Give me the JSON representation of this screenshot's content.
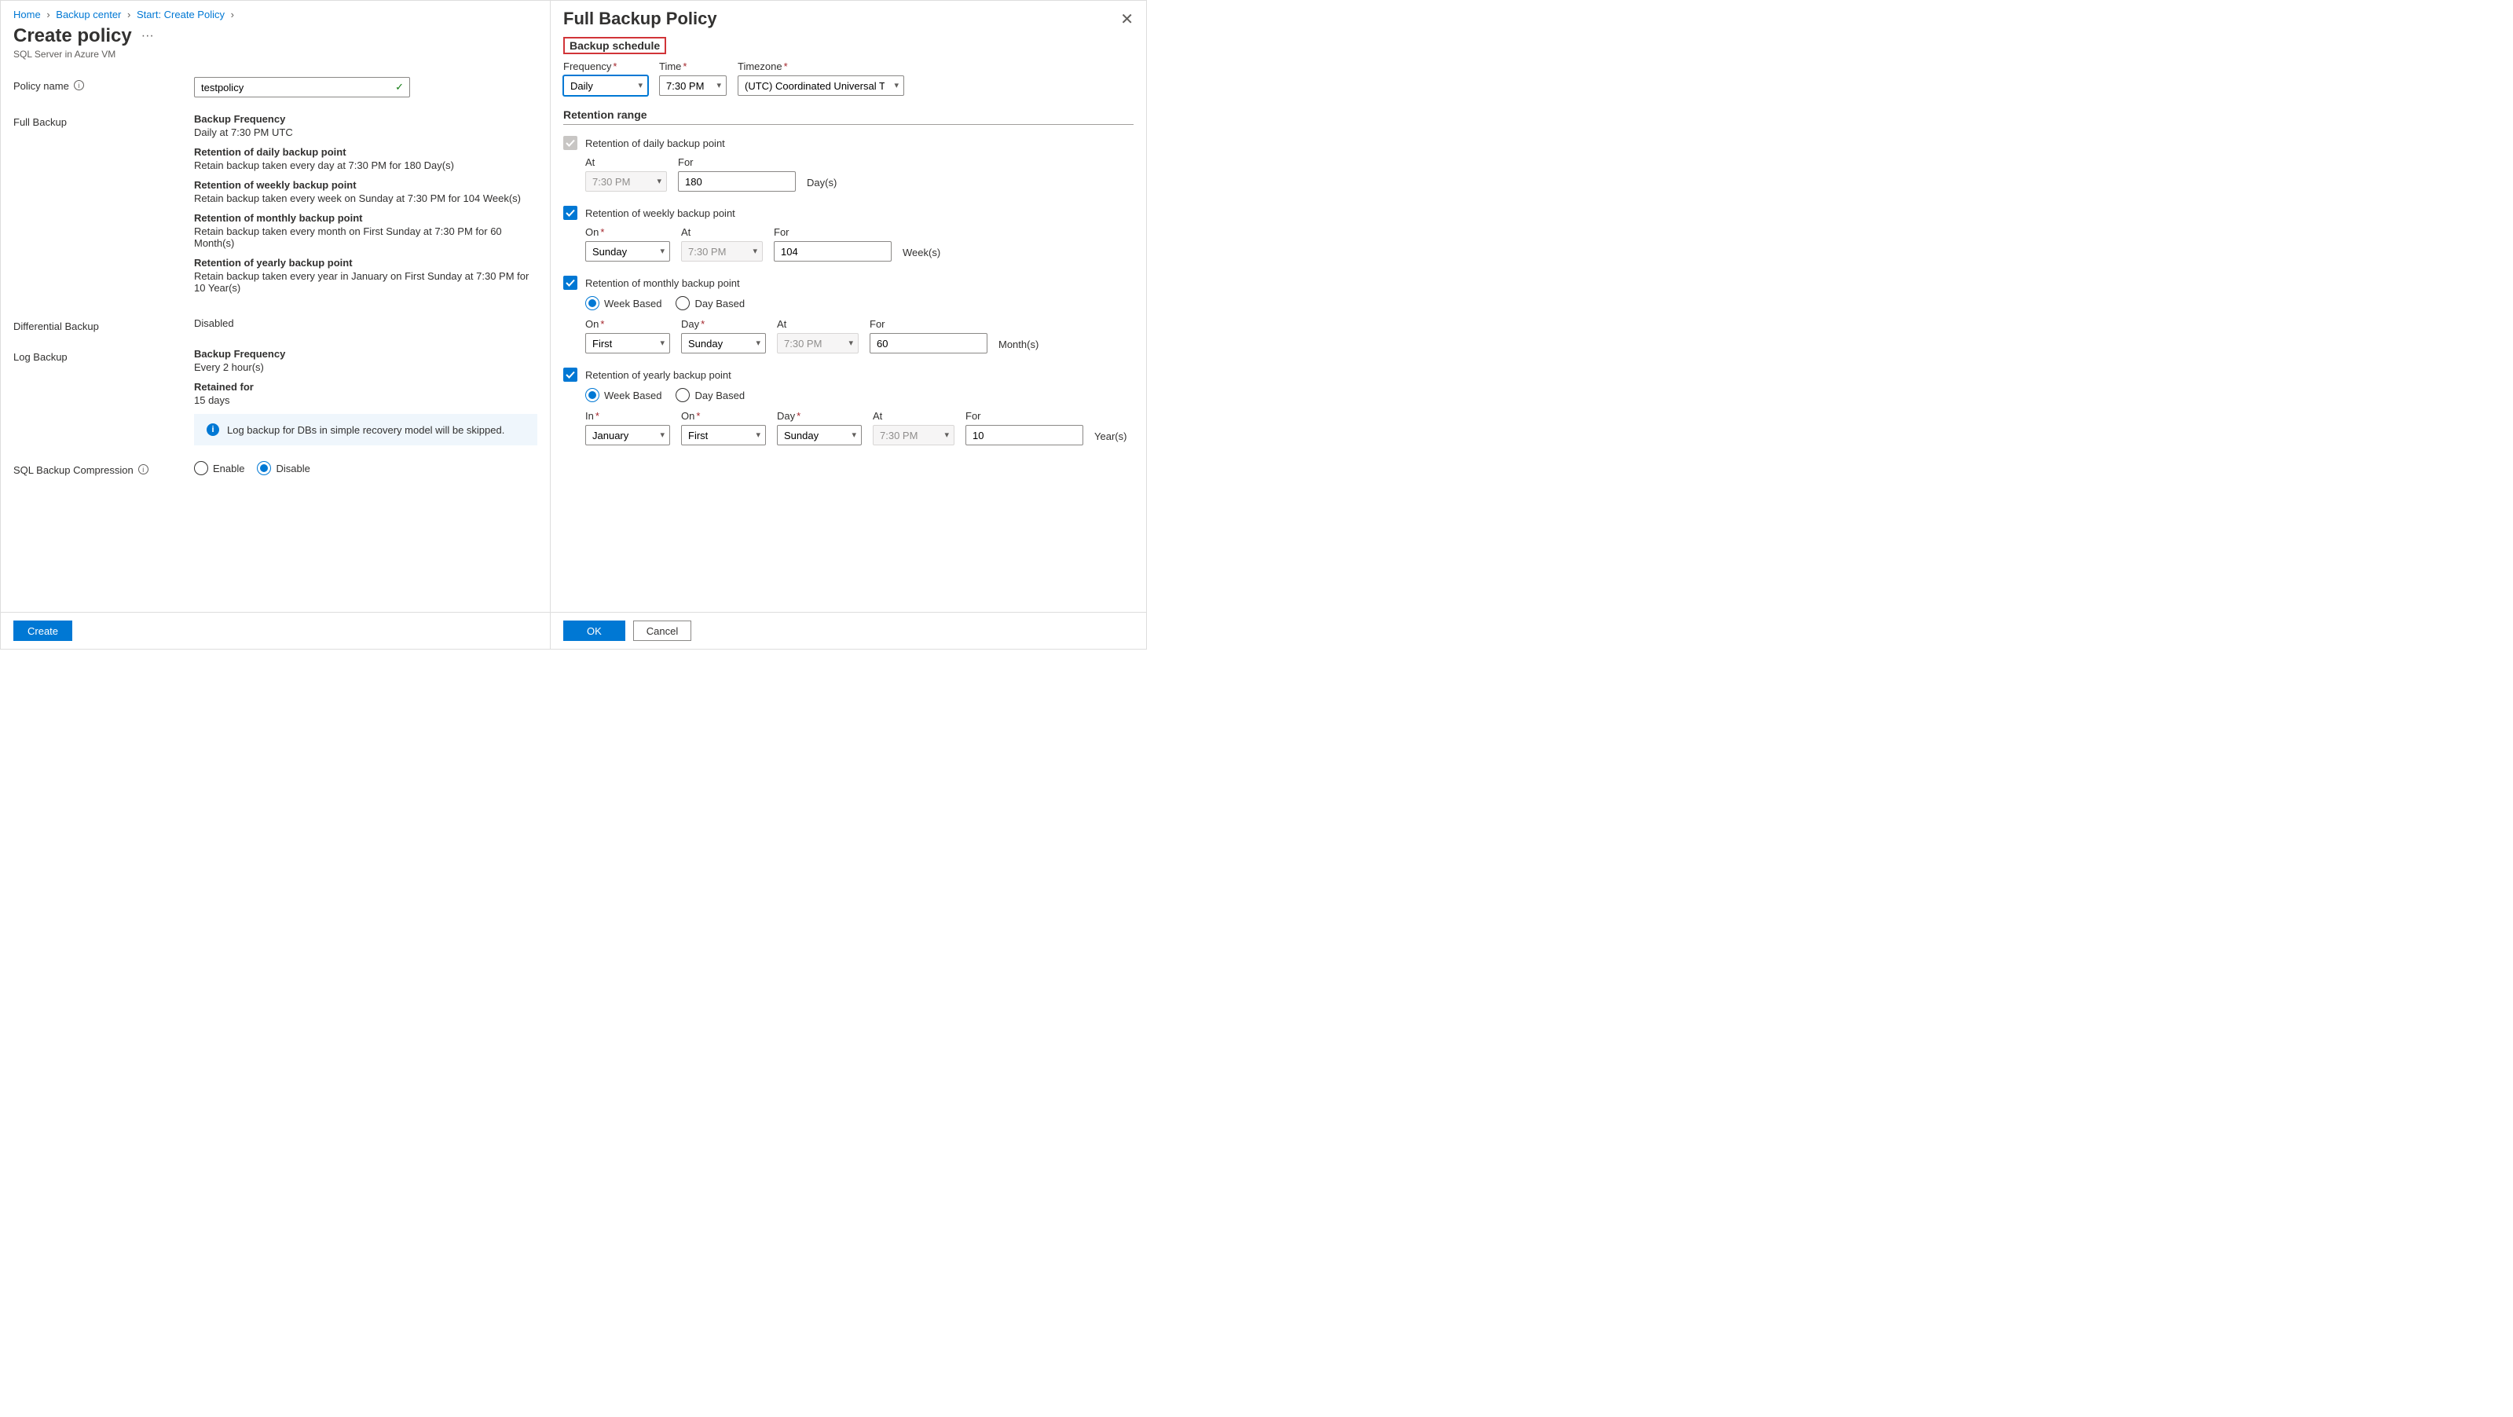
{
  "breadcrumb": {
    "home": "Home",
    "center": "Backup center",
    "start": "Start: Create Policy"
  },
  "pageTitle": "Create policy",
  "subtitle": "SQL Server in Azure VM",
  "policyName": {
    "label": "Policy name",
    "value": "testpolicy"
  },
  "fullBackup": {
    "label": "Full Backup",
    "freqTitle": "Backup Frequency",
    "freqVal": "Daily at 7:30 PM UTC",
    "dailyTitle": "Retention of daily backup point",
    "dailyVal": "Retain backup taken every day at 7:30 PM for 180 Day(s)",
    "weeklyTitle": "Retention of weekly backup point",
    "weeklyVal": "Retain backup taken every week on Sunday at 7:30 PM for 104 Week(s)",
    "monthlyTitle": "Retention of monthly backup point",
    "monthlyVal": "Retain backup taken every month on First Sunday at 7:30 PM for 60 Month(s)",
    "yearlyTitle": "Retention of yearly backup point",
    "yearlyVal": "Retain backup taken every year in January on First Sunday at 7:30 PM for 10 Year(s)"
  },
  "diff": {
    "label": "Differential Backup",
    "value": "Disabled"
  },
  "logBackup": {
    "label": "Log Backup",
    "freqTitle": "Backup Frequency",
    "freqVal": "Every 2 hour(s)",
    "retTitle": "Retained for",
    "retVal": "15 days",
    "info": "Log backup for DBs in simple recovery model will be skipped."
  },
  "compression": {
    "label": "SQL Backup Compression",
    "enable": "Enable",
    "disable": "Disable"
  },
  "createBtn": "Create",
  "panel": {
    "title": "Full Backup Policy",
    "scheduleLabel": "Backup schedule",
    "freq": {
      "label": "Frequency",
      "value": "Daily"
    },
    "time": {
      "label": "Time",
      "value": "7:30 PM"
    },
    "tz": {
      "label": "Timezone",
      "value": "(UTC) Coordinated Universal Time"
    },
    "retentionRange": "Retention range",
    "daily": {
      "label": "Retention of daily backup point",
      "at": "At",
      "atVal": "7:30 PM",
      "for": "For",
      "forVal": "180",
      "unit": "Day(s)"
    },
    "weekly": {
      "label": "Retention of weekly backup point",
      "on": "On",
      "onVal": "Sunday",
      "at": "At",
      "atVal": "7:30 PM",
      "for": "For",
      "forVal": "104",
      "unit": "Week(s)"
    },
    "monthly": {
      "label": "Retention of monthly backup point",
      "weekBased": "Week Based",
      "dayBased": "Day Based",
      "on": "On",
      "onVal": "First",
      "day": "Day",
      "dayVal": "Sunday",
      "at": "At",
      "atVal": "7:30 PM",
      "for": "For",
      "forVal": "60",
      "unit": "Month(s)"
    },
    "yearly": {
      "label": "Retention of yearly backup point",
      "weekBased": "Week Based",
      "dayBased": "Day Based",
      "in": "In",
      "inVal": "January",
      "on": "On",
      "onVal": "First",
      "day": "Day",
      "dayVal": "Sunday",
      "at": "At",
      "atVal": "7:30 PM",
      "for": "For",
      "forVal": "10",
      "unit": "Year(s)"
    },
    "ok": "OK",
    "cancel": "Cancel"
  }
}
